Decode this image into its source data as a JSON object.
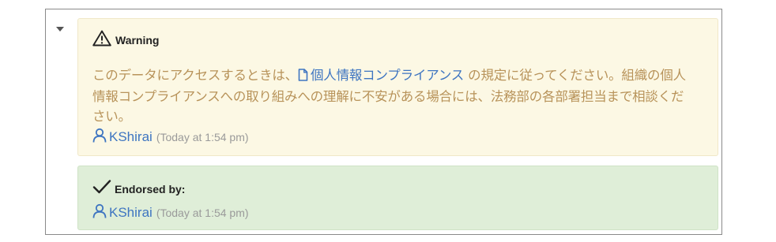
{
  "warning": {
    "title": "Warning",
    "body_before": "このデータにアクセスするときは、",
    "doc_link": "個人情報コンプライアンス",
    "body_after": " の規定に従ってください。組織の個人情報コンプライアンスへの取り組みへの理解に不安がある場合には、法務部の各部署担当まで相談ください。",
    "icon": "warning-triangle-icon",
    "user": "KShirai",
    "time": "(Today at 1:54 pm)"
  },
  "endorsement": {
    "title": "Endorsed by:",
    "icon": "checkmark-icon",
    "user": "KShirai",
    "time": "(Today at 1:54 pm)"
  },
  "colors": {
    "warning_bg": "#fcf8e4",
    "warning_text": "#b8935a",
    "endorse_bg": "#dfeed8",
    "link": "#3e75c1",
    "meta": "#9a9a9a"
  }
}
